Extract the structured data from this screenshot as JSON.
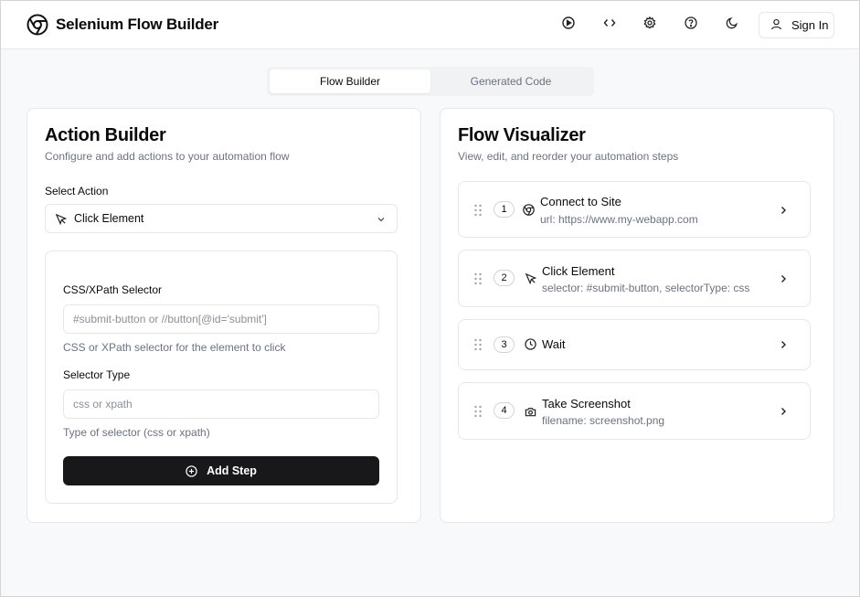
{
  "header": {
    "title": "Selenium Flow Builder",
    "icons": [
      "run-icon",
      "code-icon",
      "settings-icon",
      "help-icon",
      "dark-mode-icon"
    ],
    "sign_in_label": "Sign In"
  },
  "tabs": [
    {
      "label": "Flow Builder",
      "active": true
    },
    {
      "label": "Generated Code",
      "active": false
    }
  ],
  "action_builder": {
    "title": "Action Builder",
    "subtitle": "Configure and add actions to your automation flow",
    "select_label": "Select Action",
    "selected_action": "Click Element",
    "selector_label": "CSS/XPath Selector",
    "selector_placeholder": "#submit-button or //button[@id='submit']",
    "selector_help": "CSS or XPath selector for the element to click",
    "type_label": "Selector Type",
    "type_placeholder": "css or xpath",
    "type_help": "Type of selector (css or xpath)",
    "add_step_label": "Add Step"
  },
  "flow_visualizer": {
    "title": "Flow Visualizer",
    "subtitle": "View, edit, and reorder your automation steps",
    "steps": [
      {
        "number": "1",
        "icon": "chrome-icon",
        "title": "Connect to Site",
        "detail": "url: https://www.my-webapp.com"
      },
      {
        "number": "2",
        "icon": "pointer-icon",
        "title": "Click Element",
        "detail": "selector: #submit-button, selectorType: css"
      },
      {
        "number": "3",
        "icon": "clock-icon",
        "title": "Wait",
        "detail": ""
      },
      {
        "number": "4",
        "icon": "camera-icon",
        "title": "Take Screenshot",
        "detail": "filename: screenshot.png"
      }
    ]
  },
  "colors": {
    "primary_button": "#18181b",
    "background": "#f8f9fa",
    "border": "#e5e7eb",
    "muted_text": "#6b7280"
  }
}
